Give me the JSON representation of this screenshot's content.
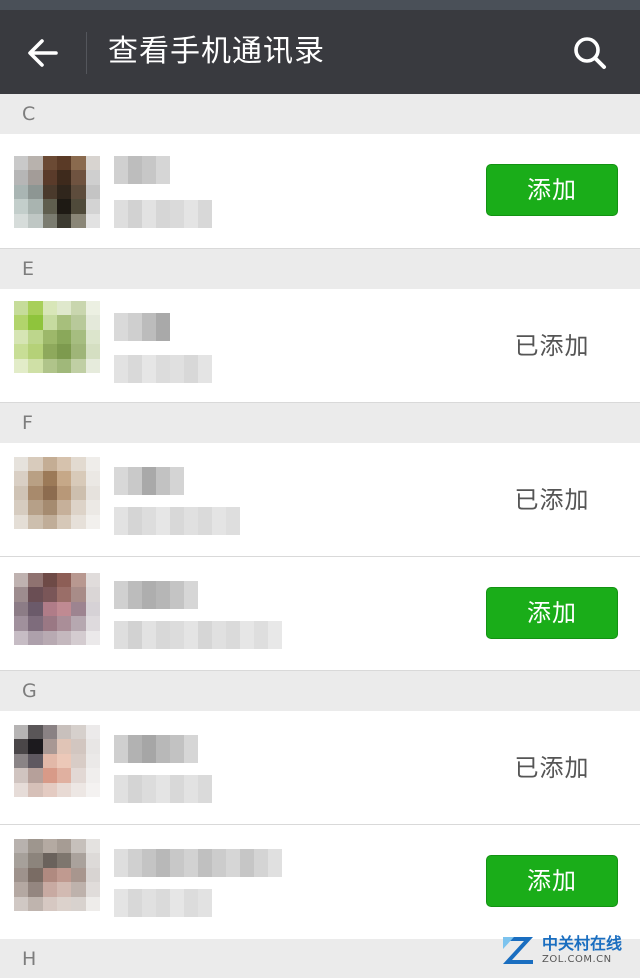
{
  "header": {
    "title": "查看手机通讯录",
    "back_icon": "arrow-left-icon",
    "search_icon": "search-icon",
    "background_color": "#393a3f"
  },
  "colors": {
    "add_button": "#1aad19",
    "section_background": "#ebebeb",
    "added_text": "#555555"
  },
  "sections": [
    {
      "letter": "C"
    },
    {
      "letter": "E"
    },
    {
      "letter": "F"
    },
    {
      "letter": "G"
    },
    {
      "letter": "H"
    }
  ],
  "contacts": [
    {
      "section": "C",
      "status": "add",
      "action_label": "添加"
    },
    {
      "section": "E",
      "status": "added",
      "action_label": "已添加"
    },
    {
      "section": "F",
      "status": "added",
      "action_label": "已添加"
    },
    {
      "section": "F",
      "status": "add",
      "action_label": "添加"
    },
    {
      "section": "G",
      "status": "added",
      "action_label": "已添加"
    },
    {
      "section": "G",
      "status": "add",
      "action_label": "添加"
    }
  ],
  "watermark": {
    "name_cn": "中关村在线",
    "domain": "ZOL.COM.CN"
  }
}
